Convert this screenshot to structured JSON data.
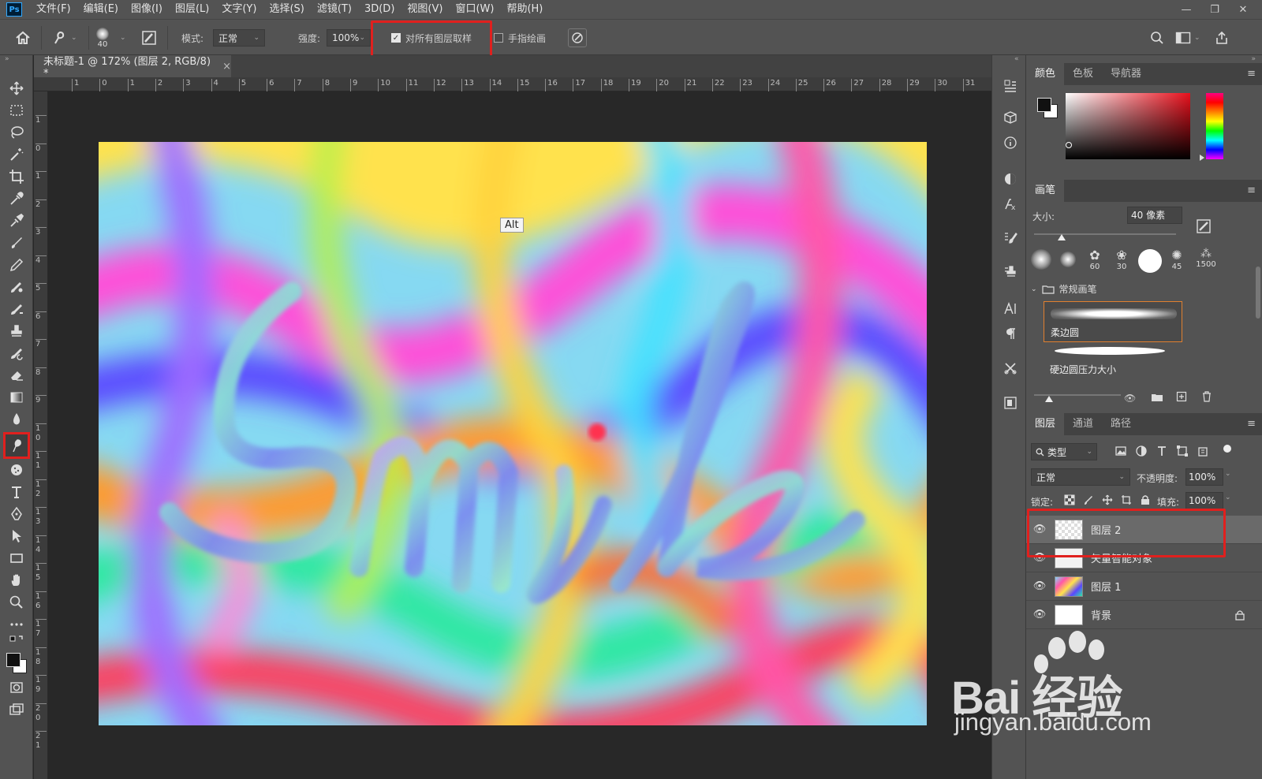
{
  "app": {
    "logo": "Ps"
  },
  "menu": [
    "文件(F)",
    "编辑(E)",
    "图像(I)",
    "图层(L)",
    "文字(Y)",
    "选择(S)",
    "滤镜(T)",
    "3D(D)",
    "视图(V)",
    "窗口(W)",
    "帮助(H)"
  ],
  "window_controls": [
    "—",
    "❐",
    "✕"
  ],
  "options": {
    "brush_size": "40",
    "mode_label": "模式:",
    "mode_value": "正常",
    "strength_label": "强度:",
    "strength_value": "100%",
    "sample_all_label": "对所有图层取样",
    "sample_all_checked": true,
    "finger_label": "手指绘画",
    "finger_checked": false
  },
  "document": {
    "tab_title": "未标题-1 @ 172% (图层 2, RGB/8) *",
    "close": "×",
    "ruler_h": [
      "1",
      "0",
      "1",
      "2",
      "3",
      "4",
      "5",
      "6",
      "7",
      "8",
      "9",
      "10",
      "11",
      "12",
      "13",
      "14",
      "15",
      "16",
      "17",
      "18",
      "19",
      "20",
      "21",
      "22",
      "23",
      "24",
      "25",
      "26",
      "27",
      "28",
      "29",
      "30",
      "31"
    ],
    "ruler_v": [
      "1",
      "0",
      "1",
      "2",
      "3",
      "4",
      "5",
      "6",
      "7",
      "8",
      "9",
      "1 0",
      "1 1",
      "1 2",
      "1 3",
      "1 4",
      "1 5",
      "1 6",
      "1 7",
      "1 8",
      "1 9",
      "2 0",
      "2 1"
    ],
    "tooltip": "Alt"
  },
  "color_panel": {
    "tabs": [
      "颜色",
      "色板",
      "导航器"
    ],
    "active_tab": "颜色",
    "hue_color": "#e8101c"
  },
  "brush_panel": {
    "title": "画笔",
    "size_label": "大小:",
    "size_value": "40 像素",
    "preset_sizes": [
      "60",
      "30",
      "45",
      "1500"
    ],
    "group_name": "常规画笔",
    "brushes": [
      "柔边圆",
      "硬边圆压力大小"
    ]
  },
  "layers_panel": {
    "tabs": [
      "图层",
      "通道",
      "路径"
    ],
    "active_tab": "图层",
    "filter_label": "类型",
    "blend_mode": "正常",
    "opacity_label": "不透明度:",
    "opacity_value": "100%",
    "lock_label": "锁定:",
    "fill_label": "填充:",
    "fill_value": "100%",
    "layers": [
      {
        "name": "图层 2",
        "selected": true
      },
      {
        "name": "矢量智能对象",
        "selected": false
      },
      {
        "name": "图层 1",
        "selected": false
      },
      {
        "name": "背景",
        "selected": false,
        "locked": true
      }
    ]
  },
  "watermark": {
    "brand": "Bai  经验",
    "url": "jingyan.baidu.com"
  },
  "accent_red": "#e0201e"
}
